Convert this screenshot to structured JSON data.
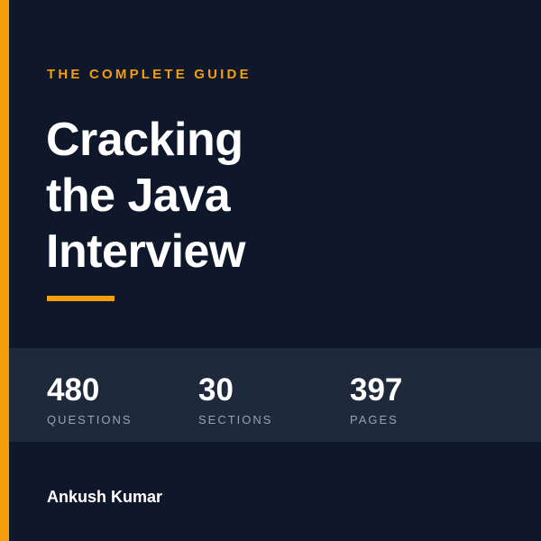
{
  "colors": {
    "background": "#0f172a",
    "accent": "#f59e0b",
    "band": "#1e293b",
    "muted": "#94a3b8",
    "text": "#ffffff"
  },
  "cover": {
    "eyebrow": "THE COMPLETE GUIDE",
    "title_lines": [
      "Cracking",
      "the Java",
      "Interview"
    ],
    "stats": [
      {
        "value": "480",
        "label": "QUESTIONS"
      },
      {
        "value": "30",
        "label": "SECTIONS"
      },
      {
        "value": "397",
        "label": "PAGES"
      }
    ],
    "author": "Ankush Kumar"
  }
}
